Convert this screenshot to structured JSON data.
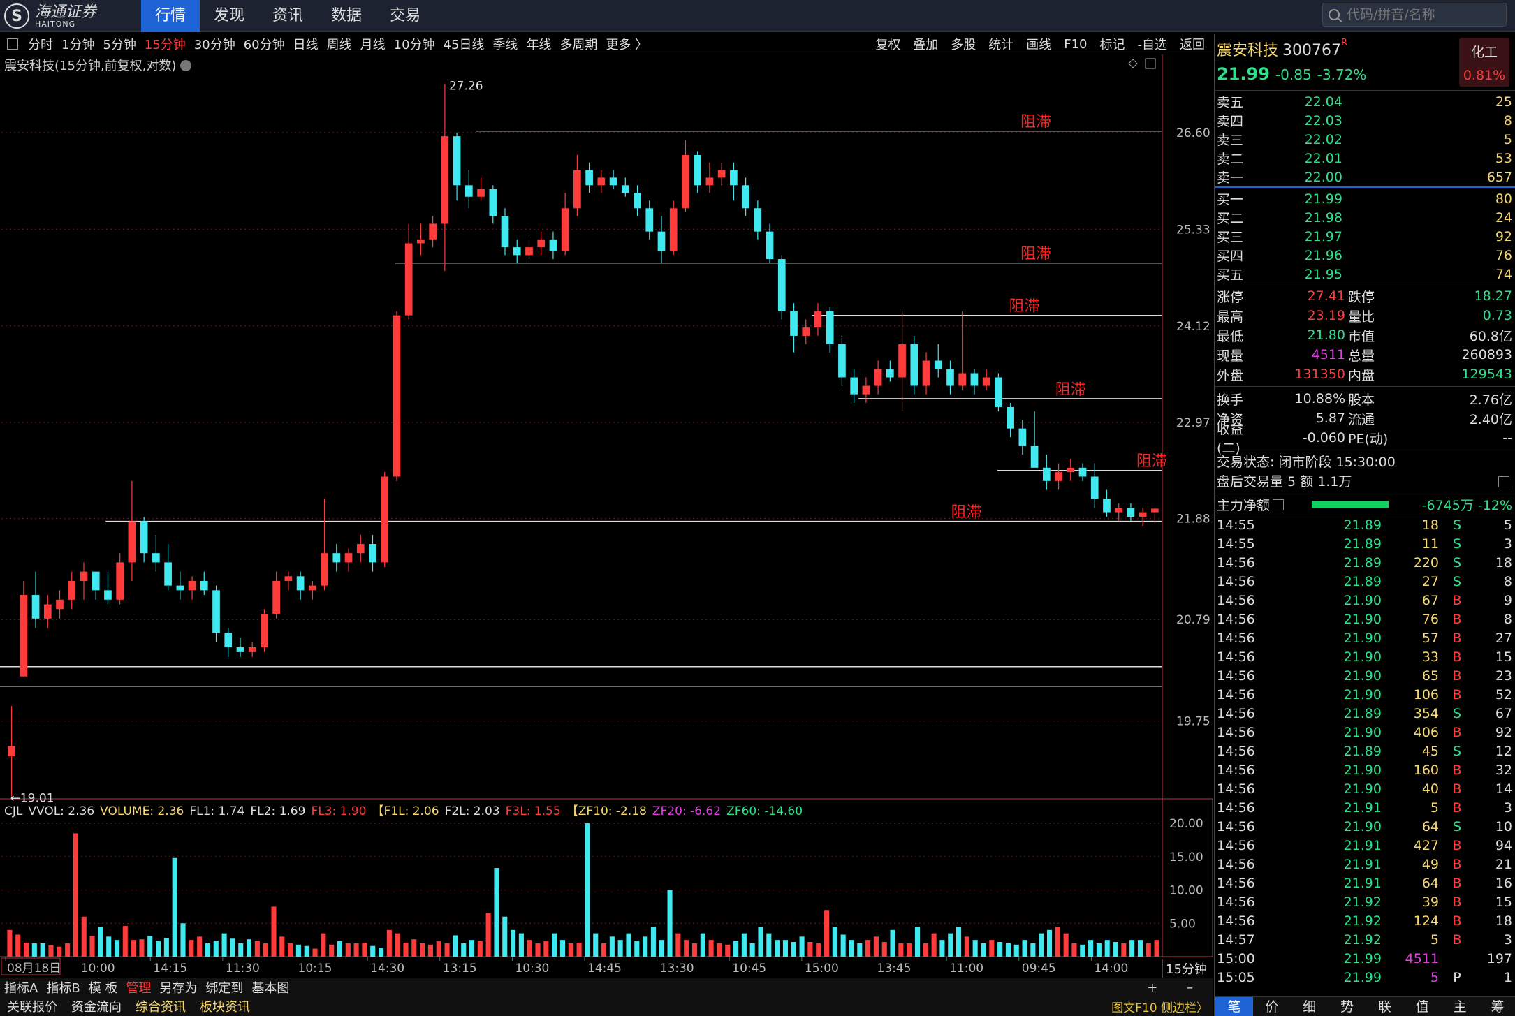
{
  "app": {
    "logo_cn": "海通证券",
    "logo_en": "HAITONG",
    "logo_mark": "S"
  },
  "nav": [
    "行情",
    "发现",
    "资讯",
    "数据",
    "交易"
  ],
  "search": {
    "placeholder": "代码/拼音/名称"
  },
  "periods": [
    "分时",
    "1分钟",
    "5分钟",
    "15分钟",
    "30分钟",
    "60分钟",
    "日线",
    "周线",
    "月线",
    "10分钟",
    "45日线",
    "季线",
    "年线",
    "多周期",
    "更多 〉"
  ],
  "active_period": "15分钟",
  "tools": [
    "复权",
    "叠加",
    "多股",
    "统计",
    "画线",
    "F10",
    "标记",
    "-自选",
    "返回"
  ],
  "chart_title": "震安科技(15分钟,前复权,对数)",
  "colors": {
    "up": "#ff3c3c",
    "down": "#40e8f0",
    "accent": "#1e64d6",
    "green": "#2ee08a"
  },
  "chart_data": {
    "type": "candlestick",
    "y_ticks": [
      26.6,
      25.33,
      24.12,
      22.97,
      21.88,
      20.79,
      19.75
    ],
    "y_tick_labels": [
      "26.60",
      "25.33",
      "24.12",
      "22.97",
      "21.88",
      "20.79",
      "19.75"
    ],
    "high_label": "27.26",
    "low_label": "←19.01",
    "ylim": [
      19.0,
      27.4
    ],
    "annotation_text": "阻滞",
    "resistance_lines": [
      {
        "price": 26.62,
        "x_from": 0.41,
        "x_to": 1.0,
        "label_x": 0.88
      },
      {
        "price": 24.9,
        "x_from": 0.34,
        "x_to": 1.0,
        "label_x": 0.88
      },
      {
        "price": 24.25,
        "x_from": 0.7,
        "x_to": 1.0,
        "label_x": 0.87
      },
      {
        "price": 23.25,
        "x_from": 0.74,
        "x_to": 1.0,
        "label_x": 0.91
      },
      {
        "price": 22.42,
        "x_from": 0.86,
        "x_to": 1.0,
        "label_x": 0.98
      },
      {
        "price": 21.85,
        "x_from": 0.09,
        "x_to": 1.0,
        "label_x": 0.82
      }
    ],
    "white_lines": [
      20.3,
      20.1
    ],
    "x_labels": [
      "08月18日",
      "10:00",
      "14:15",
      "11:30",
      "10:15",
      "14:30",
      "13:15",
      "10:30",
      "14:45",
      "13:30",
      "10:45",
      "15:00",
      "13:45",
      "11:00",
      "09:45",
      "14:00"
    ],
    "candles": [
      [
        19.4,
        19.9,
        19.01,
        19.5
      ],
      [
        20.2,
        21.2,
        20.2,
        21.05
      ],
      [
        21.05,
        21.3,
        20.7,
        20.8
      ],
      [
        20.8,
        21.05,
        20.7,
        20.95
      ],
      [
        20.9,
        21.1,
        20.8,
        21.0
      ],
      [
        21.0,
        21.3,
        20.9,
        21.2
      ],
      [
        21.2,
        21.4,
        21.0,
        21.3
      ],
      [
        21.3,
        21.2,
        21.0,
        21.1
      ],
      [
        21.1,
        21.3,
        20.95,
        21.0
      ],
      [
        21.0,
        21.5,
        20.95,
        21.4
      ],
      [
        21.4,
        22.3,
        21.2,
        21.85
      ],
      [
        21.85,
        21.9,
        21.4,
        21.5
      ],
      [
        21.5,
        21.7,
        21.3,
        21.4
      ],
      [
        21.4,
        21.6,
        21.1,
        21.15
      ],
      [
        21.15,
        21.3,
        21.0,
        21.1
      ],
      [
        21.1,
        21.25,
        21.0,
        21.2
      ],
      [
        21.2,
        21.3,
        21.05,
        21.1
      ],
      [
        21.1,
        21.15,
        20.55,
        20.65
      ],
      [
        20.65,
        20.7,
        20.4,
        20.5
      ],
      [
        20.5,
        20.6,
        20.4,
        20.45
      ],
      [
        20.45,
        20.55,
        20.4,
        20.5
      ],
      [
        20.5,
        20.9,
        20.45,
        20.85
      ],
      [
        20.85,
        21.3,
        20.8,
        21.2
      ],
      [
        21.2,
        21.3,
        21.1,
        21.25
      ],
      [
        21.25,
        21.3,
        21.0,
        21.1
      ],
      [
        21.1,
        21.2,
        21.0,
        21.15
      ],
      [
        21.15,
        22.1,
        21.1,
        21.5
      ],
      [
        21.5,
        21.6,
        21.3,
        21.4
      ],
      [
        21.4,
        21.55,
        21.3,
        21.5
      ],
      [
        21.5,
        21.7,
        21.4,
        21.6
      ],
      [
        21.6,
        21.7,
        21.3,
        21.4
      ],
      [
        21.4,
        22.4,
        21.35,
        22.35
      ],
      [
        22.35,
        24.3,
        22.3,
        24.25
      ],
      [
        24.25,
        25.4,
        24.2,
        25.15
      ],
      [
        25.15,
        25.4,
        25.0,
        25.2
      ],
      [
        25.2,
        25.5,
        25.1,
        25.4
      ],
      [
        25.4,
        27.26,
        24.8,
        26.55
      ],
      [
        26.55,
        26.6,
        25.7,
        25.9
      ],
      [
        25.9,
        26.1,
        25.6,
        25.75
      ],
      [
        25.75,
        26.0,
        25.7,
        25.85
      ],
      [
        25.85,
        25.9,
        25.4,
        25.5
      ],
      [
        25.5,
        25.6,
        25.0,
        25.1
      ],
      [
        25.1,
        25.2,
        24.9,
        25.0
      ],
      [
        25.0,
        25.2,
        24.95,
        25.1
      ],
      [
        25.1,
        25.3,
        25.0,
        25.2
      ],
      [
        25.2,
        25.3,
        24.95,
        25.05
      ],
      [
        25.05,
        25.8,
        25.0,
        25.6
      ],
      [
        25.6,
        26.3,
        25.5,
        26.1
      ],
      [
        26.1,
        26.2,
        25.8,
        25.9
      ],
      [
        25.9,
        26.1,
        25.8,
        26.0
      ],
      [
        26.0,
        26.1,
        25.85,
        25.9
      ],
      [
        25.9,
        26.0,
        25.75,
        25.8
      ],
      [
        25.8,
        25.9,
        25.5,
        25.6
      ],
      [
        25.6,
        25.7,
        25.2,
        25.3
      ],
      [
        25.3,
        25.5,
        24.9,
        25.05
      ],
      [
        25.05,
        25.7,
        25.0,
        25.6
      ],
      [
        25.6,
        26.5,
        25.55,
        26.3
      ],
      [
        26.3,
        26.35,
        25.8,
        25.9
      ],
      [
        25.9,
        26.2,
        25.8,
        26.0
      ],
      [
        26.0,
        26.2,
        25.9,
        26.1
      ],
      [
        26.1,
        26.2,
        25.7,
        25.9
      ],
      [
        25.9,
        26.0,
        25.5,
        25.6
      ],
      [
        25.6,
        25.7,
        25.2,
        25.3
      ],
      [
        25.3,
        25.4,
        24.9,
        24.95
      ],
      [
        24.95,
        25.0,
        24.2,
        24.3
      ],
      [
        24.3,
        24.4,
        23.8,
        24.0
      ],
      [
        24.0,
        24.2,
        23.9,
        24.1
      ],
      [
        24.1,
        24.4,
        24.0,
        24.3
      ],
      [
        24.3,
        24.35,
        23.8,
        23.9
      ],
      [
        23.9,
        24.0,
        23.4,
        23.5
      ],
      [
        23.5,
        23.6,
        23.2,
        23.3
      ],
      [
        23.3,
        23.5,
        23.2,
        23.4
      ],
      [
        23.4,
        23.7,
        23.3,
        23.6
      ],
      [
        23.6,
        23.7,
        23.45,
        23.5
      ],
      [
        23.5,
        24.3,
        23.1,
        23.9
      ],
      [
        23.9,
        24.0,
        23.3,
        23.4
      ],
      [
        23.4,
        23.8,
        23.3,
        23.7
      ],
      [
        23.7,
        23.9,
        23.5,
        23.6
      ],
      [
        23.6,
        23.7,
        23.3,
        23.4
      ],
      [
        23.4,
        24.3,
        23.35,
        23.55
      ],
      [
        23.55,
        23.6,
        23.3,
        23.4
      ],
      [
        23.4,
        23.6,
        23.35,
        23.5
      ],
      [
        23.5,
        23.55,
        23.1,
        23.15
      ],
      [
        23.15,
        23.2,
        22.8,
        22.9
      ],
      [
        22.9,
        23.0,
        22.6,
        22.7
      ],
      [
        22.7,
        23.1,
        22.5,
        22.45
      ],
      [
        22.45,
        22.6,
        22.2,
        22.3
      ],
      [
        22.3,
        22.5,
        22.2,
        22.4
      ],
      [
        22.4,
        22.55,
        22.3,
        22.45
      ],
      [
        22.45,
        22.5,
        22.3,
        22.35
      ],
      [
        22.35,
        22.5,
        22.0,
        22.1
      ],
      [
        22.1,
        22.2,
        21.9,
        21.95
      ],
      [
        21.95,
        22.05,
        21.85,
        22.0
      ],
      [
        22.0,
        22.05,
        21.85,
        21.9
      ],
      [
        21.9,
        22.0,
        21.8,
        21.95
      ],
      [
        21.95,
        22.0,
        21.85,
        21.99
      ]
    ],
    "volume_ticks": [
      "20.00",
      "15.00",
      "10.00",
      "5.00"
    ],
    "volume_max": 22,
    "volumes": [
      4.0,
      3.3,
      2.1,
      2.0,
      2.0,
      1.7,
      1.5,
      2.0,
      18.5,
      6.0,
      3.1,
      4.5,
      3.0,
      2.5,
      4.6,
      2.5,
      2.6,
      3.1,
      2.3,
      2.8,
      14.8,
      5.0,
      2.5,
      3.0,
      2.0,
      2.4,
      3.5,
      2.7,
      2.0,
      2.6,
      2.4,
      2.0,
      7.5,
      3.0,
      2.0,
      1.8,
      1.6,
      1.2,
      3.5,
      1.8,
      2.3,
      2.0,
      2.0,
      2.1,
      1.6,
      1.3,
      4.0,
      3.5,
      2.1,
      2.6,
      2.0,
      1.8,
      2.3,
      2.0,
      3.2,
      2.0,
      2.5,
      2.3,
      6.5,
      13.3,
      6.0,
      4.0,
      3.5,
      2.5,
      2.0,
      2.3,
      3.5,
      2.5,
      2.0,
      2.1,
      20.0,
      3.5,
      2.0,
      3.0,
      2.5,
      3.5,
      2.4,
      3.0,
      4.5,
      2.5,
      10.0,
      3.5,
      2.5,
      2.0,
      3.5,
      2.5,
      2.0,
      1.8,
      2.4,
      3.5,
      2.0,
      4.5,
      3.5,
      2.5,
      2.5,
      2.2,
      3.0,
      2.2,
      2.0,
      7.0,
      4.5,
      3.3,
      2.5,
      2.0,
      2.5,
      3.0,
      2.2,
      4.0,
      2.0,
      2.0,
      4.5,
      2.0,
      3.5,
      2.5,
      3.5,
      4.5,
      3.0,
      2.5,
      2.0,
      2.5,
      2.2,
      2.0,
      1.8,
      2.5,
      2.0,
      3.5,
      4.0,
      4.5,
      3.5,
      2.0,
      1.8,
      2.5,
      2.0,
      2.5,
      2.2,
      2.0,
      2.5,
      2.5,
      2.0,
      2.5
    ]
  },
  "indicator": {
    "name": "CJL",
    "items": [
      {
        "t": "VVOL: 2.36",
        "c": "#ddd"
      },
      {
        "t": "VOLUME: 2.36",
        "c": "#f5d76e"
      },
      {
        "t": "FL1: 1.74",
        "c": "#ddd"
      },
      {
        "t": "FL2: 1.69",
        "c": "#ddd"
      },
      {
        "t": "FL3: 1.90",
        "c": "#ff3c3c"
      },
      {
        "t": "【F1L: 2.06",
        "c": "#f5d76e"
      },
      {
        "t": "F2L: 2.03",
        "c": "#ddd"
      },
      {
        "t": "F3L: 1.55",
        "c": "#ff3c3c"
      },
      {
        "t": "【ZF10: -2.18",
        "c": "#f5d76e"
      },
      {
        "t": "ZF20: -6.62",
        "c": "#e040e0"
      },
      {
        "t": "ZF60: -14.60",
        "c": "#2ee08a"
      }
    ]
  },
  "period_label": "15分钟",
  "bottom1": [
    "指标A",
    "指标B",
    "模 板",
    "管理",
    "另存为",
    "绑定到",
    "基本图"
  ],
  "bottom1_active": "管理",
  "bottom1_pm": "+ –",
  "bottom2": [
    {
      "t": "关联报价",
      "y": false
    },
    {
      "t": "资金流向",
      "y": false
    },
    {
      "t": "综合资讯",
      "y": true
    },
    {
      "t": "板块资讯",
      "y": true
    }
  ],
  "bottom2_right": "图文F10 侧边栏〉",
  "quote": {
    "name": "震安科技",
    "code": "300767",
    "r": "R",
    "price": "21.99",
    "change": "-0.85",
    "pct": "-3.72%",
    "industry": "化工",
    "industry_pct": "0.81%"
  },
  "asks": [
    {
      "l": "卖五",
      "p": "22.04",
      "q": "25"
    },
    {
      "l": "卖四",
      "p": "22.03",
      "q": "8"
    },
    {
      "l": "卖三",
      "p": "22.02",
      "q": "5"
    },
    {
      "l": "卖二",
      "p": "22.01",
      "q": "53"
    },
    {
      "l": "卖一",
      "p": "22.00",
      "q": "657"
    }
  ],
  "bids": [
    {
      "l": "买一",
      "p": "21.99",
      "q": "80"
    },
    {
      "l": "买二",
      "p": "21.98",
      "q": "24"
    },
    {
      "l": "买三",
      "p": "21.97",
      "q": "92"
    },
    {
      "l": "买四",
      "p": "21.96",
      "q": "76"
    },
    {
      "l": "买五",
      "p": "21.95",
      "q": "74"
    }
  ],
  "stats1": [
    [
      "涨停",
      "27.41",
      "red",
      "跌停",
      "18.27",
      "grn"
    ],
    [
      "最高",
      "23.19",
      "red",
      "量比",
      "0.73",
      "grn"
    ],
    [
      "最低",
      "21.80",
      "grn",
      "市值",
      "60.8亿",
      "wht"
    ],
    [
      "现量",
      "4511",
      "mag",
      "总量",
      "260893",
      "wht"
    ],
    [
      "外盘",
      "131350",
      "red",
      "内盘",
      "129543",
      "grn"
    ]
  ],
  "stats2": [
    [
      "换手",
      "10.88%",
      "wht",
      "股本",
      "2.76亿",
      "wht"
    ],
    [
      "净资",
      "5.87",
      "wht",
      "流通",
      "2.40亿",
      "wht"
    ],
    [
      "收益(二)",
      "-0.060",
      "wht",
      "PE(动)",
      "--",
      "wht"
    ]
  ],
  "trade_status": "交易状态: 闭市阶段 15:30:00",
  "after_hours": "盘后交易量 5 额 1.1万",
  "main_flow": {
    "label": "主力净额",
    "value": "-6745万 -12%"
  },
  "ticks": [
    [
      "14:55",
      "21.89",
      "g",
      "18",
      "S",
      "5"
    ],
    [
      "14:55",
      "21.89",
      "g",
      "11",
      "S",
      "3"
    ],
    [
      "14:56",
      "21.89",
      "g",
      "220",
      "S",
      "18"
    ],
    [
      "14:56",
      "21.89",
      "g",
      "27",
      "S",
      "8"
    ],
    [
      "14:56",
      "21.90",
      "g",
      "67",
      "B",
      "9"
    ],
    [
      "14:56",
      "21.90",
      "g",
      "76",
      "B",
      "8"
    ],
    [
      "14:56",
      "21.90",
      "g",
      "57",
      "B",
      "27"
    ],
    [
      "14:56",
      "21.90",
      "g",
      "33",
      "B",
      "15"
    ],
    [
      "14:56",
      "21.90",
      "g",
      "65",
      "B",
      "23"
    ],
    [
      "14:56",
      "21.90",
      "g",
      "106",
      "B",
      "52"
    ],
    [
      "14:56",
      "21.89",
      "g",
      "354",
      "S",
      "67"
    ],
    [
      "14:56",
      "21.90",
      "g",
      "406",
      "B",
      "92"
    ],
    [
      "14:56",
      "21.89",
      "g",
      "45",
      "S",
      "12"
    ],
    [
      "14:56",
      "21.90",
      "g",
      "160",
      "B",
      "32"
    ],
    [
      "14:56",
      "21.90",
      "g",
      "40",
      "B",
      "14"
    ],
    [
      "14:56",
      "21.91",
      "g",
      "5",
      "B",
      "3"
    ],
    [
      "14:56",
      "21.90",
      "g",
      "64",
      "S",
      "10"
    ],
    [
      "14:56",
      "21.91",
      "g",
      "427",
      "B",
      "94"
    ],
    [
      "14:56",
      "21.91",
      "g",
      "49",
      "B",
      "21"
    ],
    [
      "14:56",
      "21.91",
      "g",
      "64",
      "B",
      "16"
    ],
    [
      "14:56",
      "21.92",
      "g",
      "39",
      "B",
      "15"
    ],
    [
      "14:56",
      "21.92",
      "g",
      "124",
      "B",
      "18"
    ],
    [
      "14:57",
      "21.92",
      "g",
      "5",
      "B",
      "3"
    ],
    [
      "15:00",
      "21.99",
      "g",
      "4511",
      "",
      "197"
    ],
    [
      "15:05",
      "21.99",
      "g",
      "5",
      "P",
      "1"
    ]
  ],
  "right_tabs": [
    "笔",
    "价",
    "细",
    "势",
    "联",
    "值",
    "主",
    "筹"
  ],
  "right_tab_active": "笔"
}
